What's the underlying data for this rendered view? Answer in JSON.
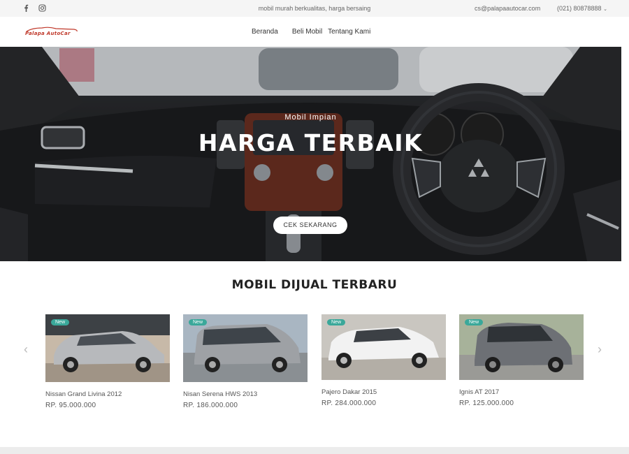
{
  "topbar": {
    "tagline": "mobil murah berkualitas, harga bersaing",
    "email": "cs@palapaautocar.com",
    "phone": "(021) 80878888",
    "social": [
      "facebook-icon",
      "instagram-icon"
    ]
  },
  "header": {
    "logo_text": "Palapa AutoCar",
    "nav": [
      "Beranda",
      "Beli Mobil",
      "Tentang Kami"
    ]
  },
  "hero": {
    "subtitle": "Mobil Impian",
    "title": "HARGA TERBAIK",
    "button": "CEK SEKARANG"
  },
  "section": {
    "title": "MOBIL DIJUAL TERBARU",
    "badge": "New",
    "cars": [
      {
        "name": "Nissan Grand Livina 2012",
        "price": "RP.  95.000.000",
        "color": "#b7b9bc"
      },
      {
        "name": "Nisan Serena HWS 2013",
        "price": "RP.  186.000.000",
        "color": "#9ea1a5"
      },
      {
        "name": "Pajero Dakar 2015",
        "price": "RP.  284.000.000",
        "color": "#f2f2f2"
      },
      {
        "name": "Ignis AT 2017",
        "price": "RP.  125.000.000",
        "color": "#6d7075"
      }
    ]
  },
  "colors": {
    "badge": "#3aa89a",
    "logo": "#c0392b"
  }
}
